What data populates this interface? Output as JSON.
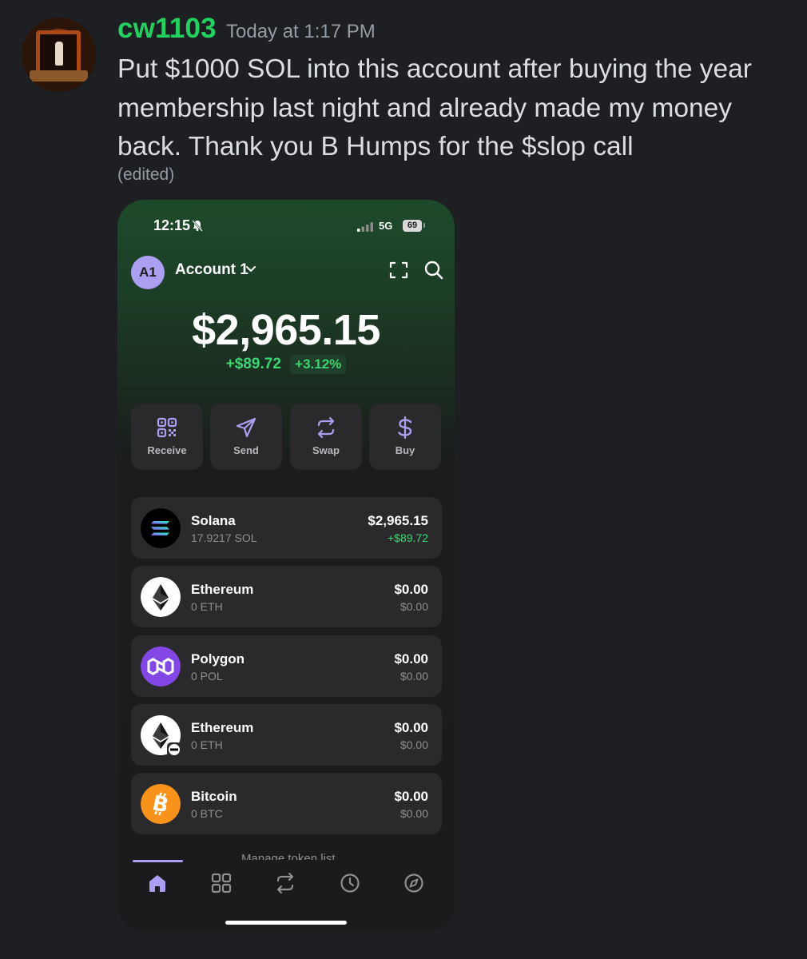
{
  "message": {
    "username": "cw1103",
    "timestamp": "Today at 1:17 PM",
    "text": "Put $1000 SOL into this account after buying the year membership last night and already made my money back. Thank you B Humps for the $slop call",
    "edited": "(edited)"
  },
  "colors": {
    "username": "#23d160",
    "accent": "#ab9ff2",
    "positive": "#3bd671"
  },
  "phone": {
    "status": {
      "time": "12:15",
      "network": "5G",
      "battery": "69"
    },
    "account": {
      "avatar": "A1",
      "name": "Account 1"
    },
    "balance": "$2,965.15",
    "change_amount": "+$89.72",
    "change_percent": "+3.12%",
    "actions": [
      {
        "label": "Receive",
        "icon": "qr-code-icon"
      },
      {
        "label": "Send",
        "icon": "send-icon"
      },
      {
        "label": "Swap",
        "icon": "swap-icon"
      },
      {
        "label": "Buy",
        "icon": "dollar-icon"
      }
    ],
    "tokens": [
      {
        "name": "Solana",
        "amount": "17.9217 SOL",
        "value": "$2,965.15",
        "change": "+$89.72",
        "icon": "solana-icon"
      },
      {
        "name": "Ethereum",
        "amount": "0 ETH",
        "value": "$0.00",
        "change": "$0.00",
        "icon": "ethereum-icon"
      },
      {
        "name": "Polygon",
        "amount": "0 POL",
        "value": "$0.00",
        "change": "$0.00",
        "icon": "polygon-icon"
      },
      {
        "name": "Ethereum",
        "amount": "0 ETH",
        "value": "$0.00",
        "change": "$0.00",
        "icon": "ethereum-base-icon"
      },
      {
        "name": "Bitcoin",
        "amount": "0 BTC",
        "value": "$0.00",
        "change": "$0.00",
        "icon": "bitcoin-icon"
      }
    ],
    "manage_label": "Manage token list",
    "tabs": [
      "home-icon",
      "collectibles-grid-icon",
      "swap-tab-icon",
      "activity-clock-icon",
      "explore-compass-icon"
    ]
  }
}
